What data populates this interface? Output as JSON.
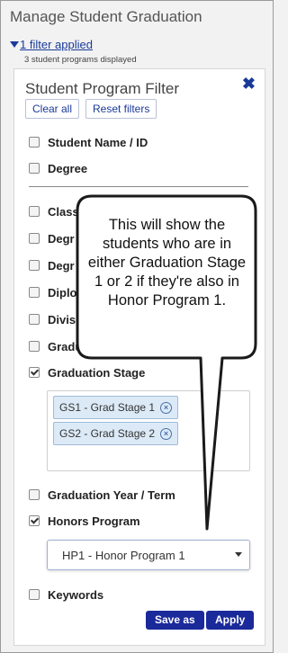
{
  "header": {
    "title": "Manage Student Graduation",
    "filter_link": "1 filter applied",
    "count_text": "3 student programs displayed"
  },
  "panel": {
    "title": "Student Program Filter",
    "clear_all": "Clear all",
    "reset_filters": "Reset filters"
  },
  "filters": {
    "student_name": {
      "label": "Student Name / ID",
      "checked": false
    },
    "degree": {
      "label": "Degree",
      "checked": false
    },
    "classification": {
      "label": "Classi",
      "checked": false
    },
    "degree2": {
      "label": "Degr",
      "checked": false
    },
    "degree3": {
      "label": "Degr",
      "checked": false
    },
    "diploma": {
      "label": "Diplo",
      "checked": false
    },
    "division": {
      "label": "Divis",
      "checked": false
    },
    "graduation": {
      "label": "Gradu",
      "checked": false
    },
    "graduation_stage": {
      "label": "Graduation Stage",
      "checked": true
    },
    "graduation_year": {
      "label": "Graduation Year / Term",
      "checked": false
    },
    "honors_program": {
      "label": "Honors Program",
      "checked": true
    },
    "keywords": {
      "label": "Keywords",
      "checked": false
    }
  },
  "graduation_stage_chips": [
    "GS1 - Grad Stage 1",
    "GS2 - Grad Stage 2"
  ],
  "honors_select": {
    "value": "HP1 - Honor Program 1"
  },
  "actions": {
    "save_as": "Save as",
    "apply": "Apply"
  },
  "callout": {
    "text": "This will show the students who are in either Graduation Stage 1 or 2 if they're also in Honor Program 1."
  }
}
